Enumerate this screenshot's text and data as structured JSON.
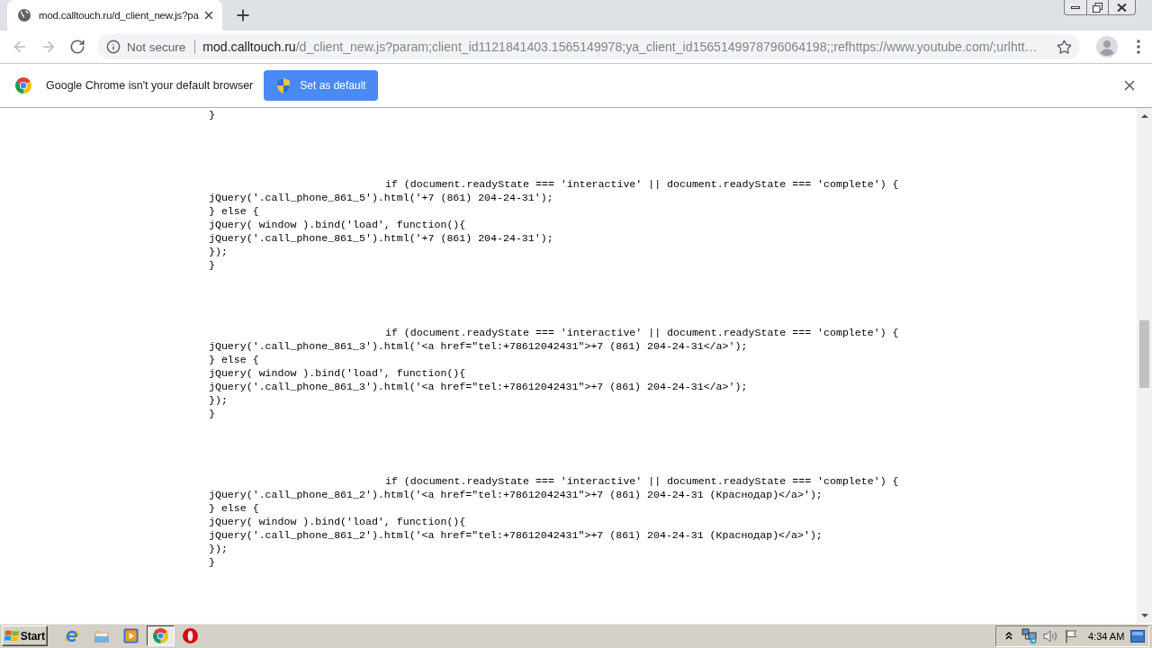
{
  "tabs": [
    {
      "title": "mod.calltouch.ru/d_client_new.js?pa",
      "selected": true
    }
  ],
  "toolbar": {
    "nav_buttons": [
      {
        "kind": "back",
        "disabled": true
      },
      {
        "kind": "forward",
        "disabled": true
      },
      {
        "kind": "reload",
        "disabled": false
      }
    ],
    "security_label": "Not secure",
    "url_host": "mod.calltouch.ru",
    "url_rest": "/d_client_new.js?param;client_id1121841403.1565149978;ya_client_id1565149978796064198;;refhttps://www.youtube.com/;urlhtt…"
  },
  "infobar": {
    "message": "Google Chrome isn't your default browser",
    "button": "Set as default"
  },
  "code": {
    "lines_before": [
      "}"
    ],
    "blocks": [
      {
        "condition": "if (document.readyState === 'interactive' || document.readyState === 'complete') {",
        "lines": [
          "jQuery('.call_phone_861_5').html('+7 (861) 204-24-31');",
          "} else {",
          "jQuery( window ).bind('load', function(){",
          "jQuery('.call_phone_861_5').html('+7 (861) 204-24-31');",
          "});",
          "}"
        ]
      },
      {
        "condition": "if (document.readyState === 'interactive' || document.readyState === 'complete') {",
        "lines": [
          "jQuery('.call_phone_861_3').html('<a href=\"tel:+78612042431\">+7 (861) 204-24-31</a>');",
          "} else {",
          "jQuery( window ).bind('load', function(){",
          "jQuery('.call_phone_861_3').html('<a href=\"tel:+78612042431\">+7 (861) 204-24-31</a>');",
          "});",
          "}"
        ]
      },
      {
        "condition": "if (document.readyState === 'interactive' || document.readyState === 'complete') {",
        "lines": [
          "jQuery('.call_phone_861_2').html('<a href=\"tel:+78612042431\">+7 (861) 204-24-31 (Краснодар)</a>');",
          "} else {",
          "jQuery( window ).bind('load', function(){",
          "jQuery('.call_phone_861_2').html('<a href=\"tel:+78612042431\">+7 (861) 204-24-31 (Краснодар)</a>');",
          "});",
          "}"
        ]
      }
    ]
  },
  "taskbar": {
    "start": "Start",
    "apps": [
      {
        "kind": "ie",
        "selected": false
      },
      {
        "kind": "explorer",
        "selected": false
      },
      {
        "kind": "media",
        "selected": false
      },
      {
        "kind": "chrome",
        "selected": true
      },
      {
        "kind": "opera",
        "selected": false
      }
    ],
    "clock": "4:34 AM"
  }
}
